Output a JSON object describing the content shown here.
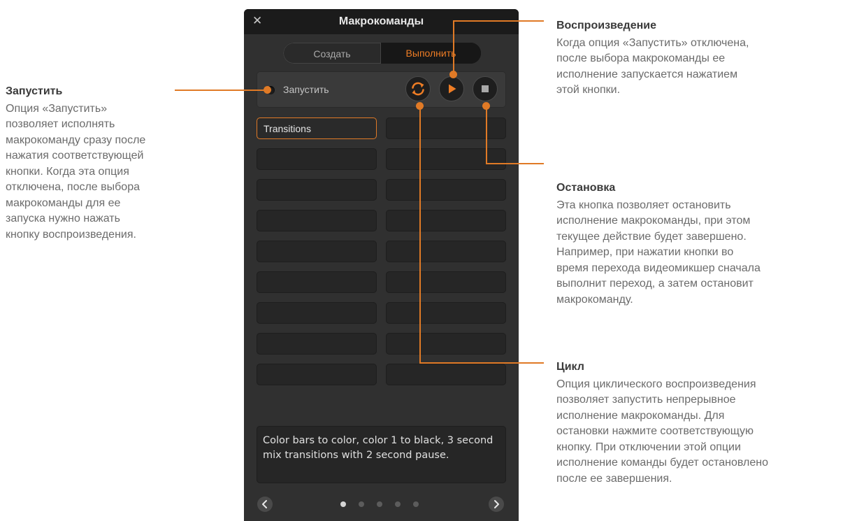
{
  "panel": {
    "title": "Макрокоманды",
    "close_icon": "close-icon",
    "tabs": [
      {
        "label": "Создать",
        "active": false
      },
      {
        "label": "Выполнить",
        "active": true
      }
    ],
    "run_option_label": "Запустить",
    "controls": [
      "loop-icon",
      "play-icon",
      "stop-icon"
    ],
    "macro_slots": [
      "Transitions",
      "",
      "",
      "",
      "",
      "",
      "",
      "",
      "",
      "",
      "",
      "",
      "",
      "",
      "",
      "",
      "",
      ""
    ],
    "selected_slot": "Transitions",
    "description": "Color bars to color, color 1 to black, 3 second mix transitions with 2 second pause.",
    "pagination": {
      "pages": 5,
      "current": 1
    }
  },
  "annotations": {
    "run": {
      "title": "Запустить",
      "lines": [
        "Опция «Запустить»",
        "позволяет исполнять",
        "макрокоманду сразу после",
        "нажатия соответствующей",
        "кнопки. Когда эта опция",
        "отключена, после выбора",
        "макрокоманды для ее",
        "запуска нужно нажать",
        "кнопку воспроизведения."
      ]
    },
    "play": {
      "title": "Воспроизведение",
      "lines": [
        "Когда опция «Запустить» отключена,",
        "после выбора макрокоманды ее",
        "исполнение запускается нажатием",
        "этой кнопки."
      ]
    },
    "stop": {
      "title": "Остановка",
      "lines": [
        "Эта кнопка позволяет остановить",
        "исполнение макрокоманды, при этом",
        "текущее действие будет завершено.",
        "Например, при нажатии кнопки во",
        "время перехода видеомикшер сначала",
        "выполнит переход, а затем остановит",
        "макрокоманду."
      ]
    },
    "loop": {
      "title": "Цикл",
      "lines": [
        "Опция циклического воспроизведения",
        "позволяет запустить непрерывное",
        "исполнение макрокоманды. Для",
        "остановки нажмите соответствующую",
        "кнопку. При отключении этой опции",
        "исполнение команды будет остановлено",
        "после ее завершения."
      ]
    }
  },
  "colors": {
    "accent": "#e07a26",
    "panel_bg": "#303030",
    "titlebar_bg": "#1b1b1b"
  }
}
